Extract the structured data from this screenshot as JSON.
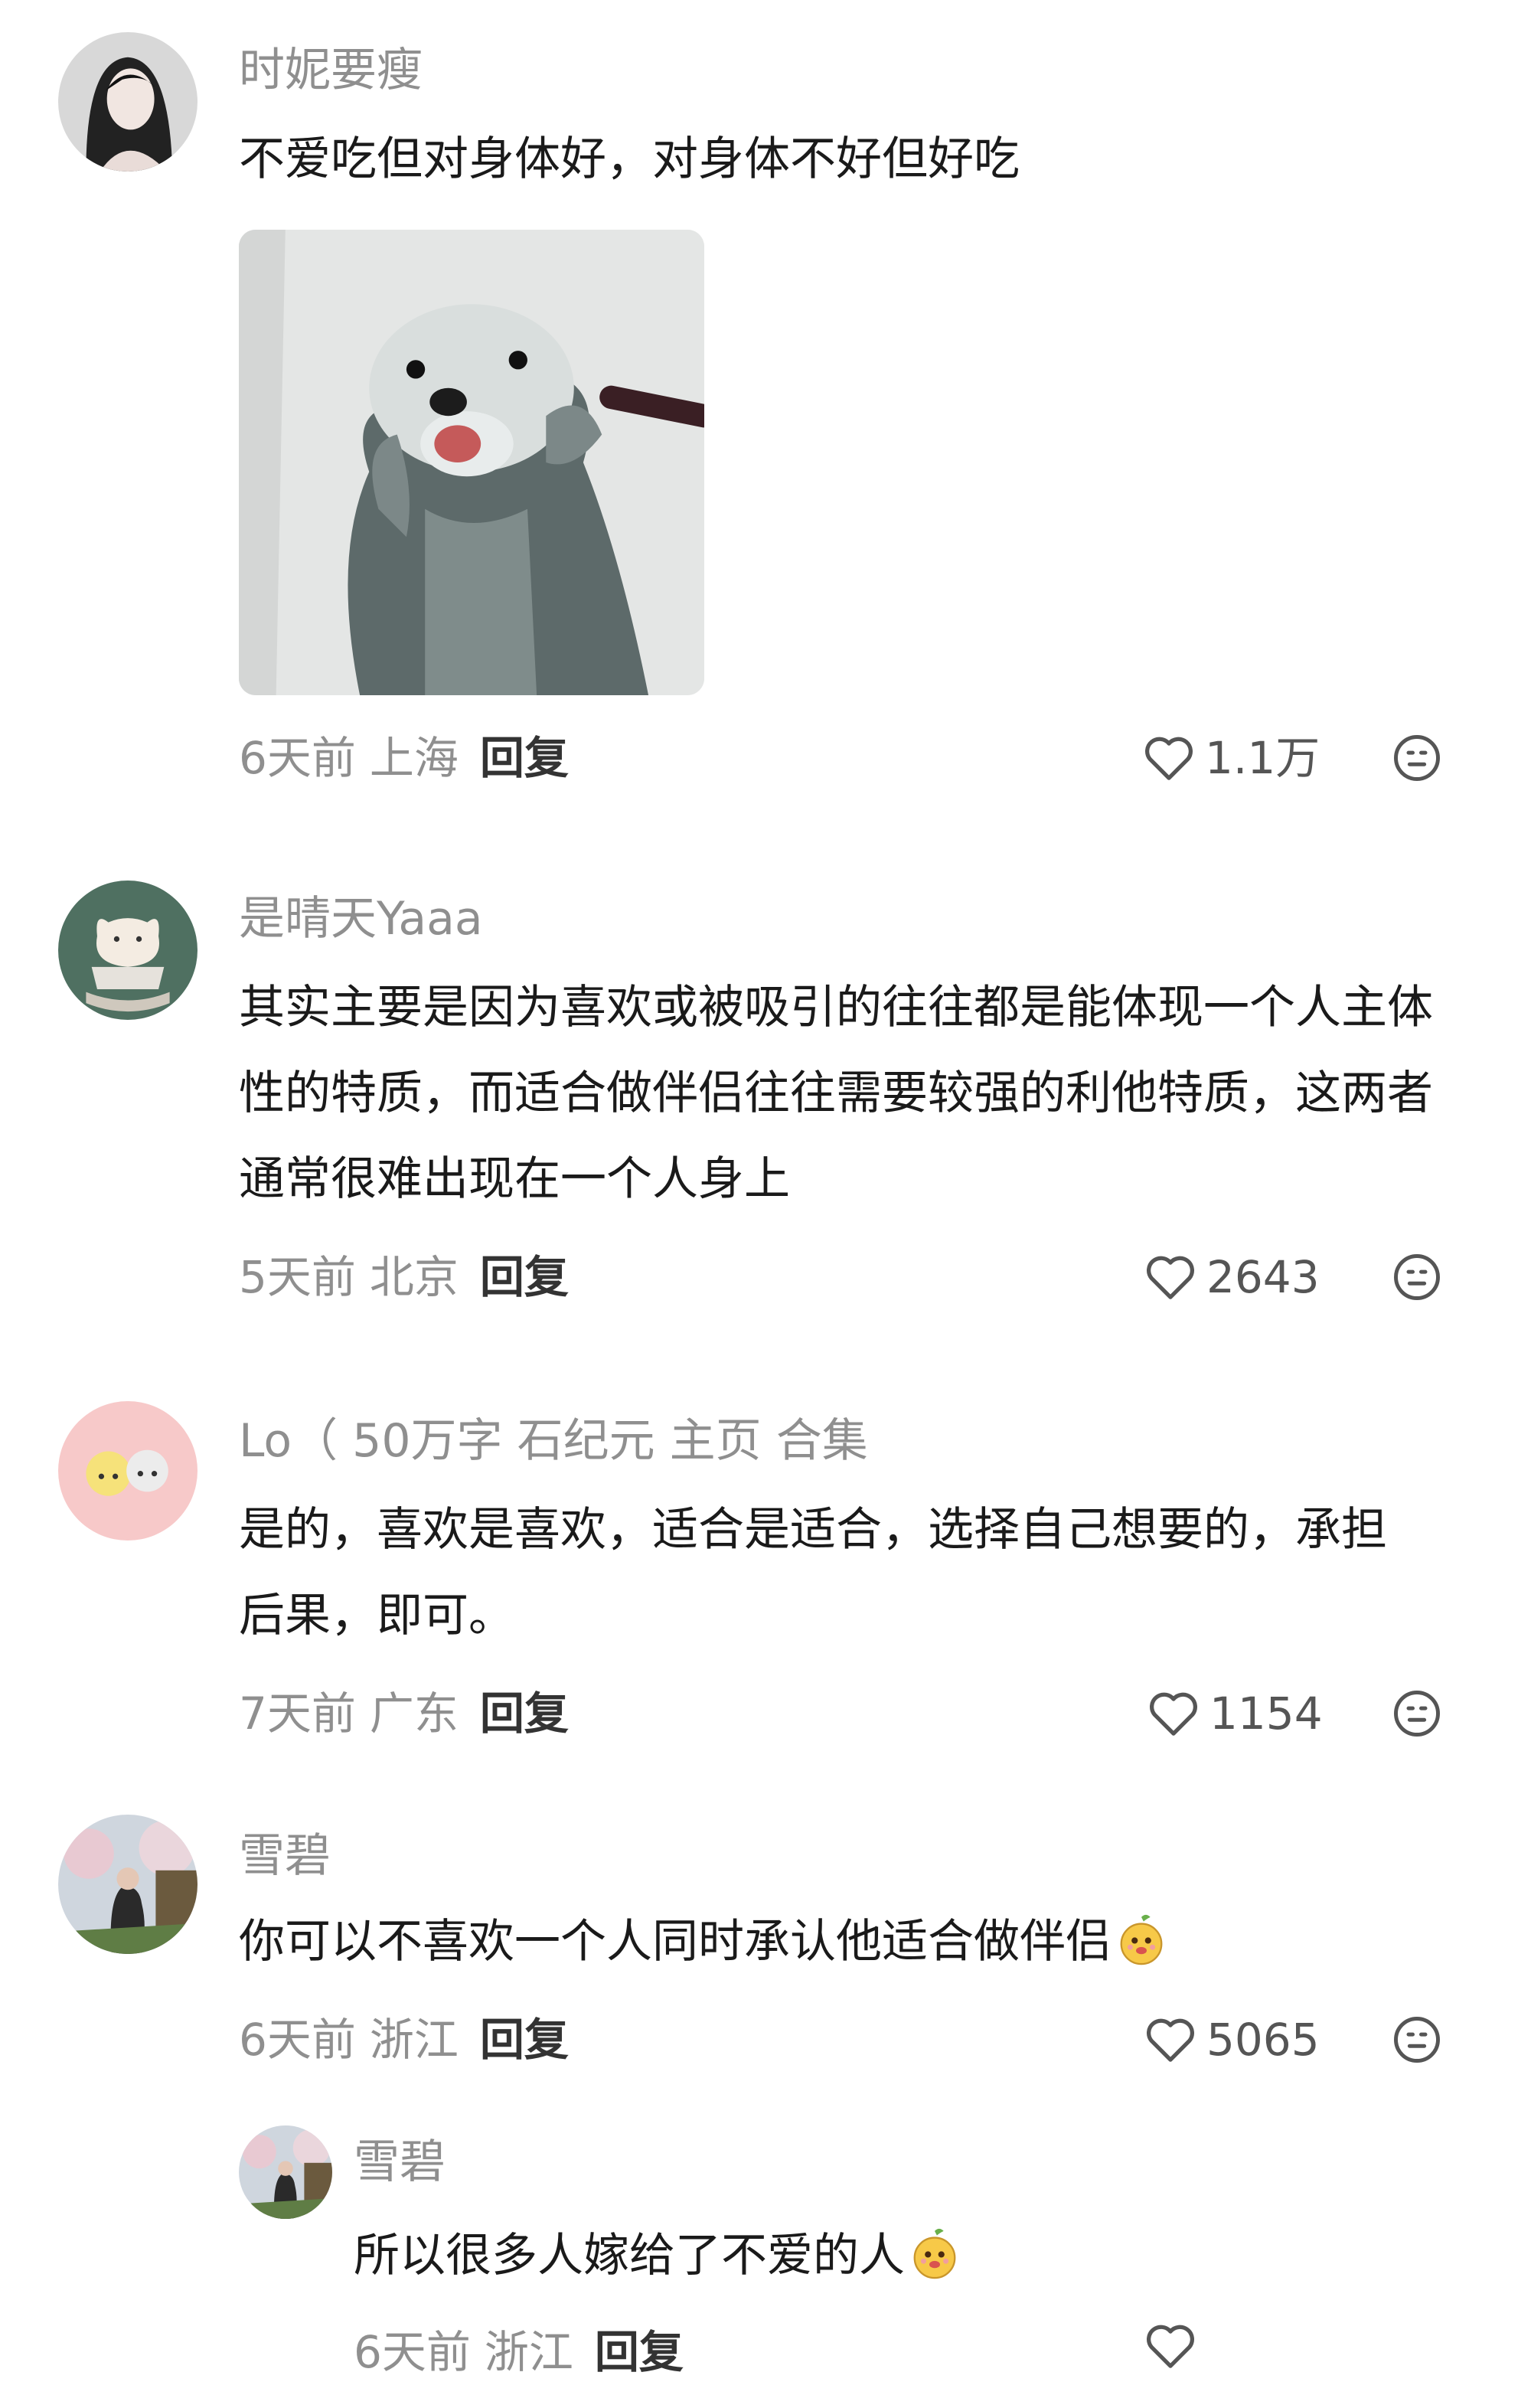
{
  "comments": [
    {
      "username": "时妮要瘦",
      "text": "不爱吃但对身体好，对身体不好但好吃",
      "time": "6天前",
      "location": "上海",
      "reply_label": "回复",
      "likes": "1.1万"
    },
    {
      "username": "是晴天Yaaa",
      "text": "其实主要是因为喜欢或被吸引的往往都是能体现一个人主体性的特质，而适合做伴侣往往需要较强的利他特质，这两者通常很难出现在一个人身上",
      "time": "5天前",
      "location": "北京",
      "reply_label": "回复",
      "likes": "2643"
    },
    {
      "username": "Lo（ 50万字 石纪元 主页 合集",
      "text": "是的，喜欢是喜欢，适合是适合，选择自己想要的，承担后果，即可。",
      "time": "7天前",
      "location": "广东",
      "reply_label": "回复",
      "likes": "1154"
    },
    {
      "username": "雪碧",
      "text": "你可以不喜欢一个人同时承认他适合做伴侣",
      "time": "6天前",
      "location": "浙江",
      "reply_label": "回复",
      "likes": "5065"
    }
  ],
  "reply": {
    "username": "雪碧",
    "text": "所以很多人嫁给了不爱的人",
    "time": "6天前",
    "location": "浙江",
    "reply_label": "回复"
  },
  "colors": {
    "username": "#8f8f8f",
    "text": "#1a1a1a",
    "meta": "#8f8f8f",
    "reply": "#333333"
  },
  "icons": [
    "heart-icon",
    "emoji-face-icon",
    "mango-emoji-icon"
  ]
}
